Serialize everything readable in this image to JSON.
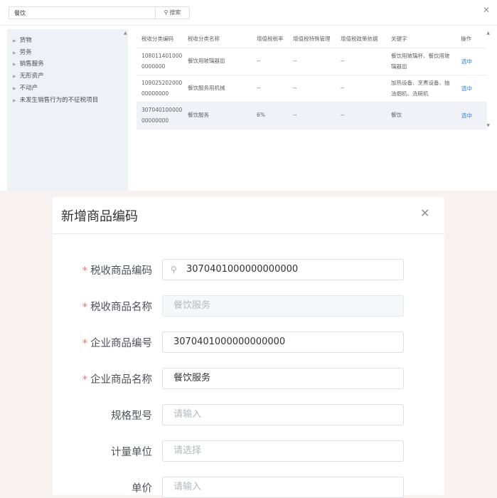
{
  "search": {
    "value": "餐饮",
    "button_label": "搜索"
  },
  "panel": {
    "close_icon": "close-icon"
  },
  "tree": {
    "items": [
      "货物",
      "劳务",
      "销售服务",
      "无形资产",
      "不动产",
      "未发生销售行为的不征税项目"
    ]
  },
  "table": {
    "headers": [
      "税收分类编码",
      "税收分类名称",
      "增值税税率",
      "增值税特殊管理",
      "增值税政策依据",
      "关键字",
      "操作"
    ],
    "rows": [
      {
        "code1": "108011401000",
        "code2": "0000000",
        "name": "餐饮用玻璃器皿",
        "rate": "--",
        "special": "--",
        "policy": "--",
        "kw1": "餐饮用玻璃杯、餐饮用玻",
        "kw2": "璃器皿",
        "action": "选中"
      },
      {
        "code1": "109025202000",
        "code2": "00000000",
        "name": "餐饮服务用机械",
        "rate": "--",
        "special": "--",
        "policy": "--",
        "kw1": "加热设备、烹煮设备、抽",
        "kw2": "油烟机、洗碗机",
        "action": "选中"
      },
      {
        "code1": "307040100000",
        "code2": "00000000",
        "name": "餐饮服务",
        "rate": "6%",
        "special": "--",
        "policy": "--",
        "kw1": "餐饮",
        "kw2": "",
        "action": "选中"
      }
    ]
  },
  "dialog": {
    "title": "新增商品编码",
    "close_icon": "close-icon",
    "fields": {
      "tax_code": {
        "label": "税收商品编码",
        "value": "3070401000000000000",
        "required": true
      },
      "tax_name": {
        "label": "税收商品名称",
        "value": "餐饮服务",
        "required": true
      },
      "company_code": {
        "label": "企业商品编号",
        "value": "3070401000000000000",
        "required": true
      },
      "company_name": {
        "label": "企业商品名称",
        "value": "餐饮服务",
        "required": true
      },
      "spec": {
        "label": "规格型号",
        "placeholder": "请输入"
      },
      "unit": {
        "label": "计量单位",
        "placeholder": "请选择"
      },
      "price": {
        "label": "单价",
        "placeholder": "请输入"
      }
    },
    "required_mark": "*"
  }
}
